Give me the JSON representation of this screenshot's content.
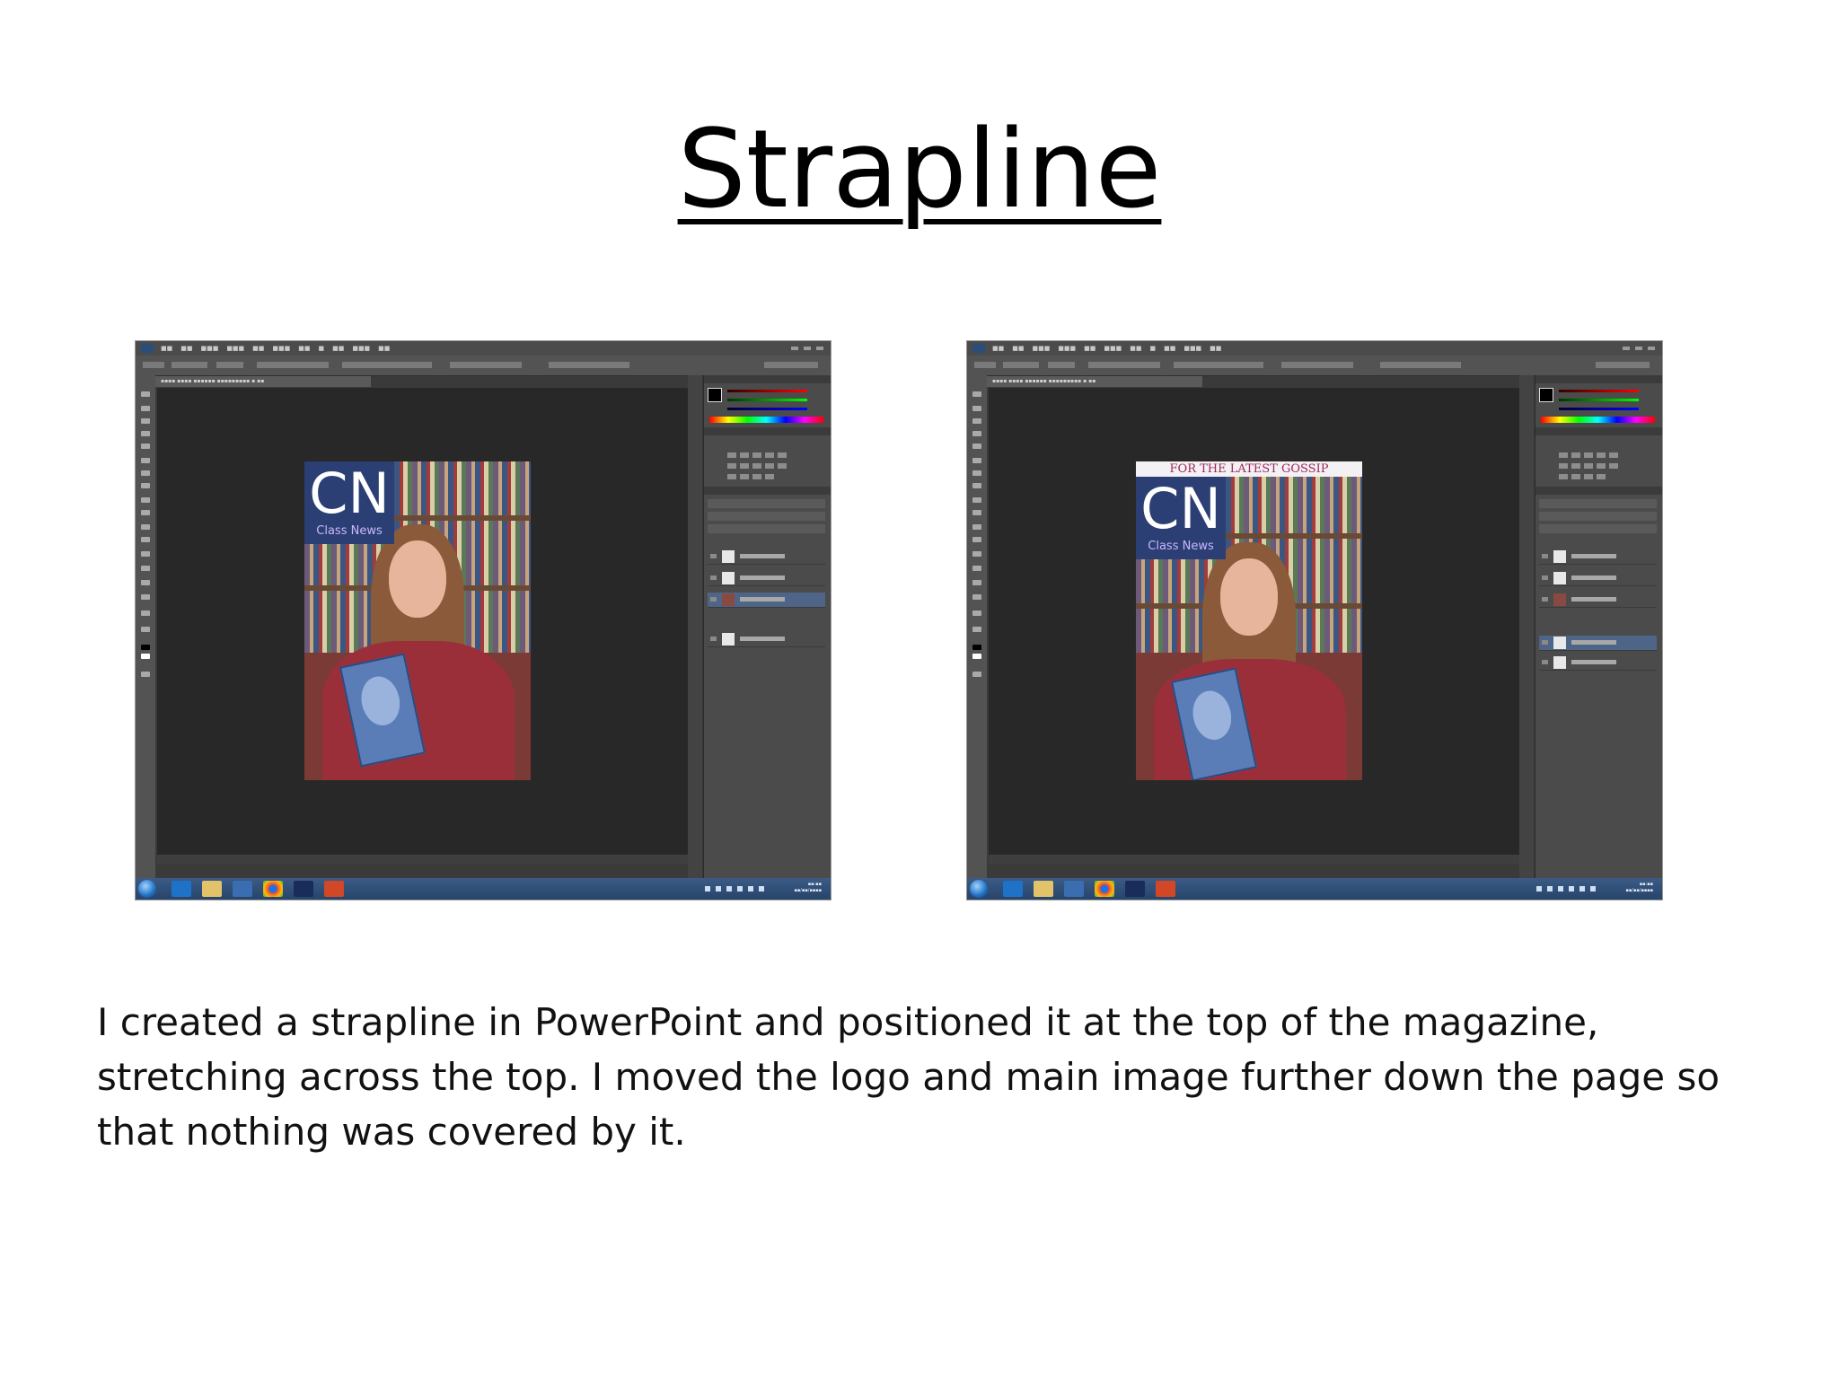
{
  "slide": {
    "title": "Strapline",
    "body": "I created a strapline in PowerPoint and positioned it at the top of the magazine, stretching across the top. I moved the logo and main image further down the page so that nothing was covered by it."
  },
  "screenshots": [
    {
      "id": "before",
      "logo": {
        "main": "CN",
        "sub": "Class News"
      },
      "strapline": null
    },
    {
      "id": "after",
      "logo": {
        "main": "CN",
        "sub": "Class News"
      },
      "strapline": "FOR THE LATEST GOSSIP"
    }
  ],
  "colors": {
    "photoshop_bg": "#3a3a3a",
    "logo_bg": "#2b3f74",
    "strapline_text": "#9a2a5a",
    "taskbar": "#3b5c86"
  },
  "icons": [
    "photoshop-logo-icon",
    "windows-start-icon",
    "internet-explorer-icon",
    "folder-icon",
    "media-player-icon",
    "chrome-icon",
    "photoshop-taskbar-icon",
    "powerpoint-taskbar-icon"
  ]
}
